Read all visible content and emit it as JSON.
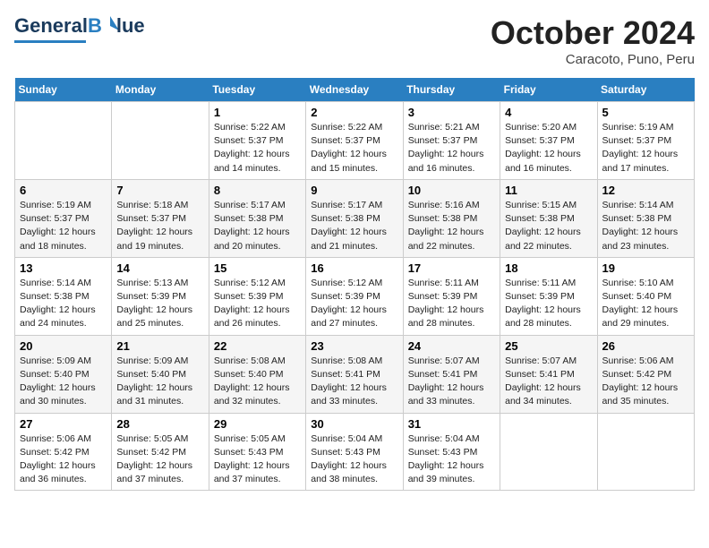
{
  "header": {
    "logo_line1": "General",
    "logo_line2": "Blue",
    "month": "October 2024",
    "location": "Caracoto, Puno, Peru"
  },
  "days_of_week": [
    "Sunday",
    "Monday",
    "Tuesday",
    "Wednesday",
    "Thursday",
    "Friday",
    "Saturday"
  ],
  "weeks": [
    [
      {
        "day": "",
        "sunrise": "",
        "sunset": "",
        "daylight": ""
      },
      {
        "day": "",
        "sunrise": "",
        "sunset": "",
        "daylight": ""
      },
      {
        "day": "1",
        "sunrise": "Sunrise: 5:22 AM",
        "sunset": "Sunset: 5:37 PM",
        "daylight": "Daylight: 12 hours and 14 minutes."
      },
      {
        "day": "2",
        "sunrise": "Sunrise: 5:22 AM",
        "sunset": "Sunset: 5:37 PM",
        "daylight": "Daylight: 12 hours and 15 minutes."
      },
      {
        "day": "3",
        "sunrise": "Sunrise: 5:21 AM",
        "sunset": "Sunset: 5:37 PM",
        "daylight": "Daylight: 12 hours and 16 minutes."
      },
      {
        "day": "4",
        "sunrise": "Sunrise: 5:20 AM",
        "sunset": "Sunset: 5:37 PM",
        "daylight": "Daylight: 12 hours and 16 minutes."
      },
      {
        "day": "5",
        "sunrise": "Sunrise: 5:19 AM",
        "sunset": "Sunset: 5:37 PM",
        "daylight": "Daylight: 12 hours and 17 minutes."
      }
    ],
    [
      {
        "day": "6",
        "sunrise": "Sunrise: 5:19 AM",
        "sunset": "Sunset: 5:37 PM",
        "daylight": "Daylight: 12 hours and 18 minutes."
      },
      {
        "day": "7",
        "sunrise": "Sunrise: 5:18 AM",
        "sunset": "Sunset: 5:37 PM",
        "daylight": "Daylight: 12 hours and 19 minutes."
      },
      {
        "day": "8",
        "sunrise": "Sunrise: 5:17 AM",
        "sunset": "Sunset: 5:38 PM",
        "daylight": "Daylight: 12 hours and 20 minutes."
      },
      {
        "day": "9",
        "sunrise": "Sunrise: 5:17 AM",
        "sunset": "Sunset: 5:38 PM",
        "daylight": "Daylight: 12 hours and 21 minutes."
      },
      {
        "day": "10",
        "sunrise": "Sunrise: 5:16 AM",
        "sunset": "Sunset: 5:38 PM",
        "daylight": "Daylight: 12 hours and 22 minutes."
      },
      {
        "day": "11",
        "sunrise": "Sunrise: 5:15 AM",
        "sunset": "Sunset: 5:38 PM",
        "daylight": "Daylight: 12 hours and 22 minutes."
      },
      {
        "day": "12",
        "sunrise": "Sunrise: 5:14 AM",
        "sunset": "Sunset: 5:38 PM",
        "daylight": "Daylight: 12 hours and 23 minutes."
      }
    ],
    [
      {
        "day": "13",
        "sunrise": "Sunrise: 5:14 AM",
        "sunset": "Sunset: 5:38 PM",
        "daylight": "Daylight: 12 hours and 24 minutes."
      },
      {
        "day": "14",
        "sunrise": "Sunrise: 5:13 AM",
        "sunset": "Sunset: 5:39 PM",
        "daylight": "Daylight: 12 hours and 25 minutes."
      },
      {
        "day": "15",
        "sunrise": "Sunrise: 5:12 AM",
        "sunset": "Sunset: 5:39 PM",
        "daylight": "Daylight: 12 hours and 26 minutes."
      },
      {
        "day": "16",
        "sunrise": "Sunrise: 5:12 AM",
        "sunset": "Sunset: 5:39 PM",
        "daylight": "Daylight: 12 hours and 27 minutes."
      },
      {
        "day": "17",
        "sunrise": "Sunrise: 5:11 AM",
        "sunset": "Sunset: 5:39 PM",
        "daylight": "Daylight: 12 hours and 28 minutes."
      },
      {
        "day": "18",
        "sunrise": "Sunrise: 5:11 AM",
        "sunset": "Sunset: 5:39 PM",
        "daylight": "Daylight: 12 hours and 28 minutes."
      },
      {
        "day": "19",
        "sunrise": "Sunrise: 5:10 AM",
        "sunset": "Sunset: 5:40 PM",
        "daylight": "Daylight: 12 hours and 29 minutes."
      }
    ],
    [
      {
        "day": "20",
        "sunrise": "Sunrise: 5:09 AM",
        "sunset": "Sunset: 5:40 PM",
        "daylight": "Daylight: 12 hours and 30 minutes."
      },
      {
        "day": "21",
        "sunrise": "Sunrise: 5:09 AM",
        "sunset": "Sunset: 5:40 PM",
        "daylight": "Daylight: 12 hours and 31 minutes."
      },
      {
        "day": "22",
        "sunrise": "Sunrise: 5:08 AM",
        "sunset": "Sunset: 5:40 PM",
        "daylight": "Daylight: 12 hours and 32 minutes."
      },
      {
        "day": "23",
        "sunrise": "Sunrise: 5:08 AM",
        "sunset": "Sunset: 5:41 PM",
        "daylight": "Daylight: 12 hours and 33 minutes."
      },
      {
        "day": "24",
        "sunrise": "Sunrise: 5:07 AM",
        "sunset": "Sunset: 5:41 PM",
        "daylight": "Daylight: 12 hours and 33 minutes."
      },
      {
        "day": "25",
        "sunrise": "Sunrise: 5:07 AM",
        "sunset": "Sunset: 5:41 PM",
        "daylight": "Daylight: 12 hours and 34 minutes."
      },
      {
        "day": "26",
        "sunrise": "Sunrise: 5:06 AM",
        "sunset": "Sunset: 5:42 PM",
        "daylight": "Daylight: 12 hours and 35 minutes."
      }
    ],
    [
      {
        "day": "27",
        "sunrise": "Sunrise: 5:06 AM",
        "sunset": "Sunset: 5:42 PM",
        "daylight": "Daylight: 12 hours and 36 minutes."
      },
      {
        "day": "28",
        "sunrise": "Sunrise: 5:05 AM",
        "sunset": "Sunset: 5:42 PM",
        "daylight": "Daylight: 12 hours and 37 minutes."
      },
      {
        "day": "29",
        "sunrise": "Sunrise: 5:05 AM",
        "sunset": "Sunset: 5:43 PM",
        "daylight": "Daylight: 12 hours and 37 minutes."
      },
      {
        "day": "30",
        "sunrise": "Sunrise: 5:04 AM",
        "sunset": "Sunset: 5:43 PM",
        "daylight": "Daylight: 12 hours and 38 minutes."
      },
      {
        "day": "31",
        "sunrise": "Sunrise: 5:04 AM",
        "sunset": "Sunset: 5:43 PM",
        "daylight": "Daylight: 12 hours and 39 minutes."
      },
      {
        "day": "",
        "sunrise": "",
        "sunset": "",
        "daylight": ""
      },
      {
        "day": "",
        "sunrise": "",
        "sunset": "",
        "daylight": ""
      }
    ]
  ]
}
